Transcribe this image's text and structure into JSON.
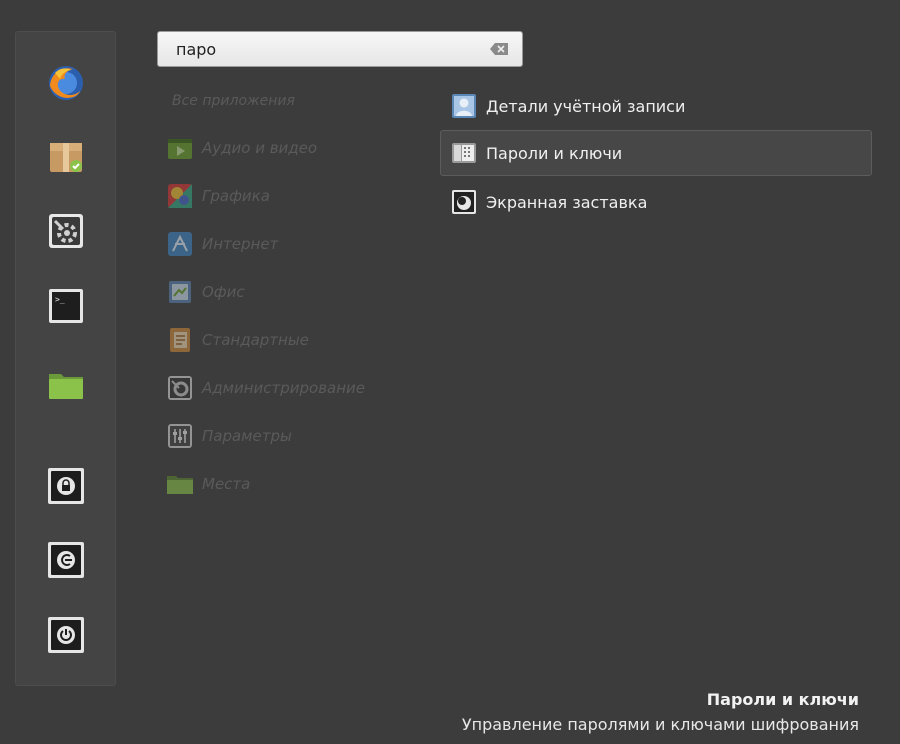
{
  "search": {
    "value": "паро",
    "placeholder": ""
  },
  "sidebar": {
    "favorites": [
      {
        "icon": "firefox-icon"
      },
      {
        "icon": "package-manager-icon"
      },
      {
        "icon": "system-settings-icon"
      },
      {
        "icon": "terminal-icon"
      },
      {
        "icon": "folder-icon"
      }
    ],
    "session": [
      {
        "icon": "lock-icon"
      },
      {
        "icon": "logout-icon"
      },
      {
        "icon": "power-icon"
      }
    ]
  },
  "categories": {
    "all_label": "Все приложения",
    "items": [
      {
        "label": "Аудио и видео",
        "icon": "multimedia-icon"
      },
      {
        "label": "Графика",
        "icon": "graphics-icon"
      },
      {
        "label": "Интернет",
        "icon": "internet-icon"
      },
      {
        "label": "Офис",
        "icon": "office-icon"
      },
      {
        "label": "Стандартные",
        "icon": "accessories-icon"
      },
      {
        "label": "Администрирование",
        "icon": "administration-icon"
      },
      {
        "label": "Параметры",
        "icon": "preferences-icon"
      },
      {
        "label": "Места",
        "icon": "places-folder-icon"
      }
    ]
  },
  "results": [
    {
      "label": "Детали учётной записи",
      "icon": "user-account-icon",
      "selected": false
    },
    {
      "label": "Пароли и ключи",
      "icon": "passwords-keys-icon",
      "selected": true
    },
    {
      "label": "Экранная заставка",
      "icon": "screensaver-icon",
      "selected": false
    }
  ],
  "description": {
    "title": "Пароли и ключи",
    "text": "Управление паролями и ключами шифрования"
  },
  "colors": {
    "background": "#3c3c3c",
    "sidebar": "#444444",
    "selected_row": "#474747",
    "dim_text": "#5a5a5a"
  }
}
